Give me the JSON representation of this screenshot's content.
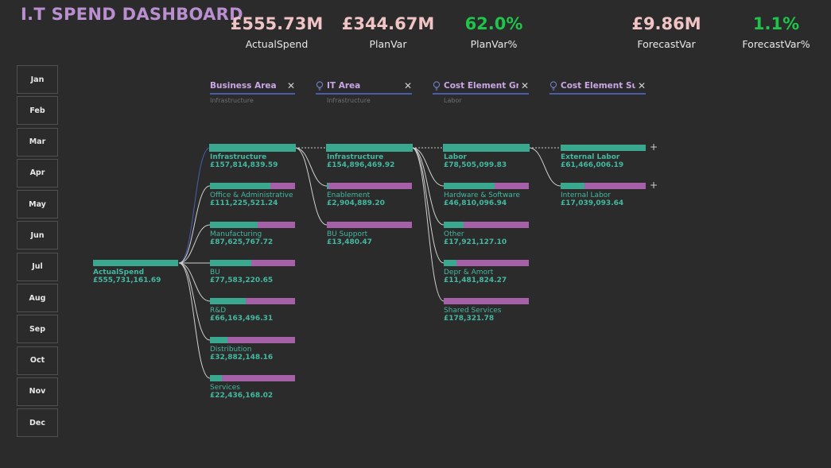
{
  "title": "I.T SPEND DASHBOARD",
  "kpis": [
    {
      "value": "£555.73M",
      "label": "ActualSpend",
      "color": "#f0c4c4"
    },
    {
      "value": "£344.67M",
      "label": "PlanVar",
      "color": "#f0c4c4"
    },
    {
      "value": "62.0%",
      "label": "PlanVar%",
      "color": "#1fc44a"
    },
    {
      "value": "£9.86M",
      "label": "ForecastVar",
      "color": "#f0c4c4"
    },
    {
      "value": "1.1%",
      "label": "ForecastVar%",
      "color": "#1fc44a"
    }
  ],
  "months": [
    "Jan",
    "Feb",
    "Mar",
    "Apr",
    "May",
    "Jun",
    "Jul",
    "Aug",
    "Sep",
    "Oct",
    "Nov",
    "Dec"
  ],
  "levels": [
    {
      "label": "Business Area",
      "selected": "Infrastructure",
      "bulb": false
    },
    {
      "label": "IT Area",
      "selected": "Infrastructure",
      "bulb": true
    },
    {
      "label": "Cost Element Gr...",
      "selected": "Labor",
      "bulb": true
    },
    {
      "label": "Cost Element Su...",
      "selected": "",
      "bulb": true
    }
  ],
  "root": {
    "label": "ActualSpend",
    "value": "£555,731,161.69",
    "fill": 1.0
  },
  "business_area": [
    {
      "label": "Infrastructure",
      "value": "£157,814,839.59",
      "fill": 1.0,
      "selected": true
    },
    {
      "label": "Office & Administrative",
      "value": "£111,225,521.24",
      "fill": 0.71
    },
    {
      "label": "Manufacturing",
      "value": "£87,625,767.72",
      "fill": 0.56
    },
    {
      "label": "BU",
      "value": "£77,583,220.65",
      "fill": 0.49
    },
    {
      "label": "R&D",
      "value": "£66,163,496.31",
      "fill": 0.42
    },
    {
      "label": "Distribution",
      "value": "£32,882,148.16",
      "fill": 0.21
    },
    {
      "label": "Services",
      "value": "£22,436,168.02",
      "fill": 0.14
    }
  ],
  "it_area": [
    {
      "label": "Infrastructure",
      "value": "£154,896,469.92",
      "fill": 1.0,
      "selected": true
    },
    {
      "label": "Enablement",
      "value": "£2,904,889.20",
      "fill": 0.02
    },
    {
      "label": "BU Support",
      "value": "£13,480.47",
      "fill": 0.0
    }
  ],
  "cost_group": [
    {
      "label": "Labor",
      "value": "£78,505,099.83",
      "fill": 1.0,
      "selected": true
    },
    {
      "label": "Hardware & Software",
      "value": "£46,810,096.94",
      "fill": 0.6
    },
    {
      "label": "Other",
      "value": "£17,921,127.10",
      "fill": 0.23
    },
    {
      "label": "Depr & Amort",
      "value": "£11,481,824.27",
      "fill": 0.15
    },
    {
      "label": "Shared Services",
      "value": "£178,321.78",
      "fill": 0.0
    }
  ],
  "cost_sub": [
    {
      "label": "External Labor",
      "value": "£61,466,006.19",
      "fill": 1.0
    },
    {
      "label": "Internal Labor",
      "value": "£17,039,093.64",
      "fill": 0.28
    }
  ],
  "colors": {
    "bar_fill": "#3aa88e",
    "bar_rest": "#a560a8",
    "link": "#cfcfcf",
    "link_selected": "#4a5dab"
  }
}
